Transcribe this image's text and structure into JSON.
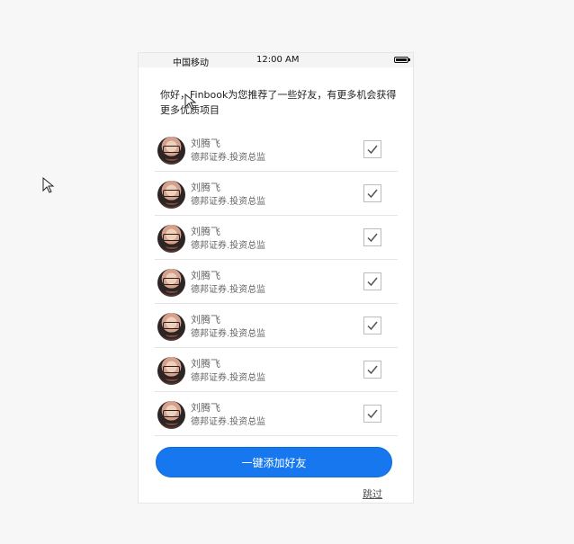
{
  "status_bar": {
    "carrier": "中国移动",
    "time": "12:00 AM",
    "battery_icon": "battery-icon"
  },
  "intro": {
    "message": "你好，Finbook为您推荐了一些好友，有更多机会获得更多优质项目"
  },
  "friends": [
    {
      "name": "刘腾飞",
      "title": "德邦证券.投资总监",
      "avatar_icon": "person-avatar",
      "checked": true,
      "check_icon": "checkmark-icon"
    },
    {
      "name": "刘腾飞",
      "title": "德邦证券.投资总监",
      "avatar_icon": "person-avatar",
      "checked": true,
      "check_icon": "checkmark-icon"
    },
    {
      "name": "刘腾飞",
      "title": "德邦证券.投资总监",
      "avatar_icon": "person-avatar",
      "checked": true,
      "check_icon": "checkmark-icon"
    },
    {
      "name": "刘腾飞",
      "title": "德邦证券.投资总监",
      "avatar_icon": "person-avatar",
      "checked": true,
      "check_icon": "checkmark-icon"
    },
    {
      "name": "刘腾飞",
      "title": "德邦证券.投资总监",
      "avatar_icon": "person-avatar",
      "checked": true,
      "check_icon": "checkmark-icon"
    },
    {
      "name": "刘腾飞",
      "title": "德邦证券.投资总监",
      "avatar_icon": "person-avatar",
      "checked": true,
      "check_icon": "checkmark-icon"
    },
    {
      "name": "刘腾飞",
      "title": "德邦证券.投资总监",
      "avatar_icon": "person-avatar",
      "checked": true,
      "check_icon": "checkmark-icon"
    }
  ],
  "actions": {
    "add_all_label": "一键添加好友",
    "skip_label": "跳过"
  },
  "colors": {
    "primary_button": "#1677ee",
    "background": "#f7f7f8",
    "panel": "#ffffff",
    "divider": "#e5e5e5"
  },
  "icons": {
    "cursor": "arrow-cursor"
  }
}
